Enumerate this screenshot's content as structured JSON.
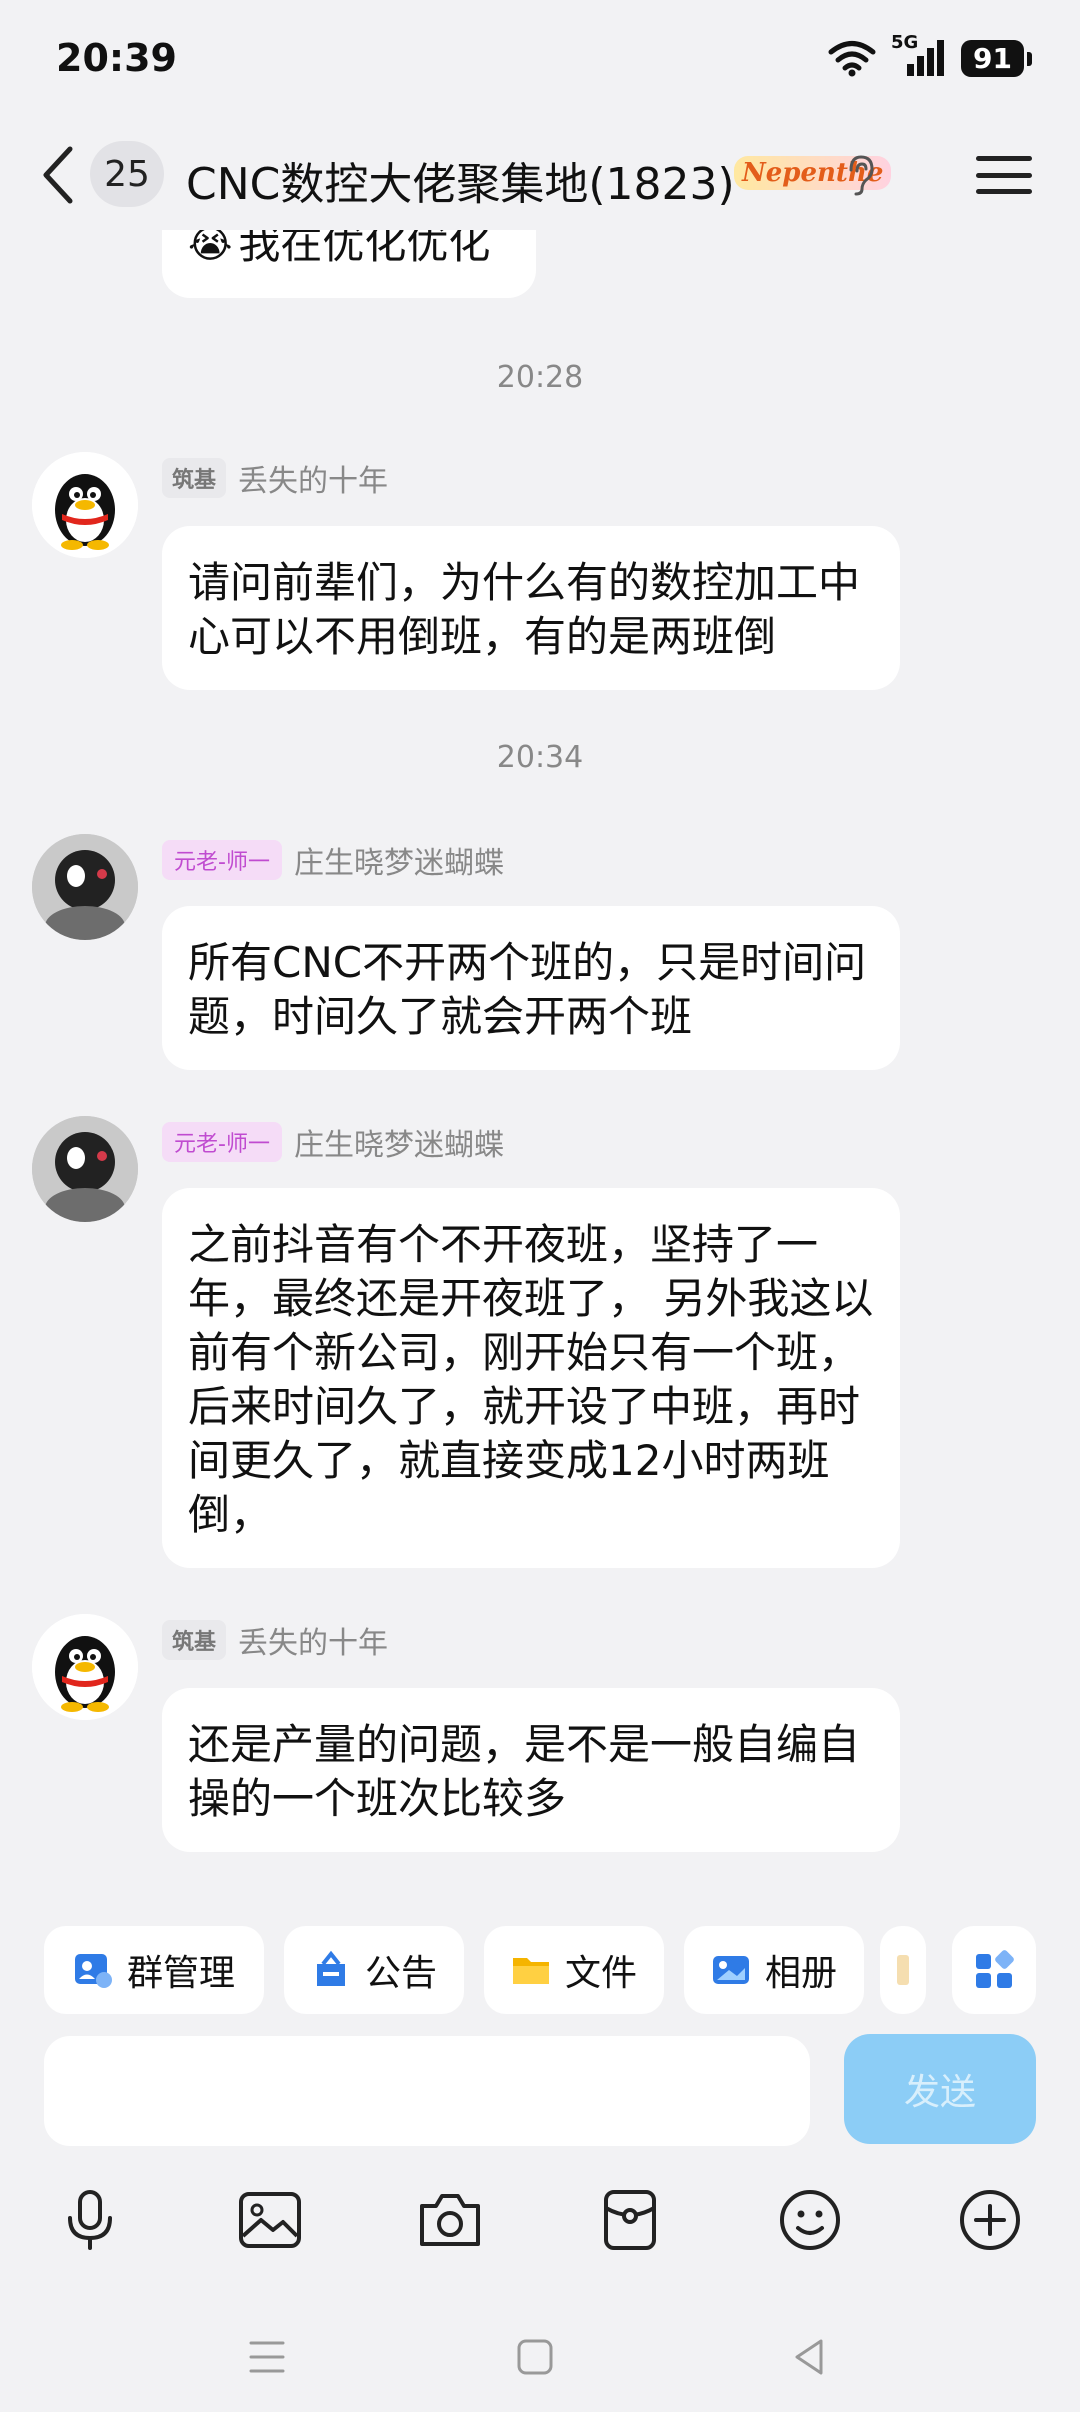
{
  "status_bar": {
    "time": "20:39",
    "network": "5G",
    "battery": "91"
  },
  "header": {
    "unread_count": "25",
    "title": "CNC数控大佬聚集地(1823)",
    "title_badge": "Nepenthe"
  },
  "messages": [
    {
      "text": "我在优化优化"
    },
    {
      "timestamp": "20:28"
    },
    {
      "level_badge": "筑基",
      "sender": "丢失的十年",
      "text": "请问前辈们，为什么有的数控加工中心可以不用倒班，有的是两班倒"
    },
    {
      "timestamp": "20:34"
    },
    {
      "level_badge": "元老-师一",
      "sender": "庄生晓梦迷蝴蝶",
      "text": "所有CNC不开两个班的，只是时间问题，时间久了就会开两个班"
    },
    {
      "level_badge": "元老-师一",
      "sender": "庄生晓梦迷蝴蝶",
      "text": "之前抖音有个不开夜班，坚持了一年，最终还是开夜班了，  另外我这以前有个新公司，刚开始只有一个班，后来时间久了，就开设了中班，再时间更久了，就直接变成12小时两班倒，"
    },
    {
      "level_badge": "筑基",
      "sender": "丢失的十年",
      "text": "还是产量的问题，是不是一般自编自操的一个班次比较多"
    }
  ],
  "toolbar": {
    "group_manage": "群管理",
    "announcement": "公告",
    "files": "文件",
    "album": "相册"
  },
  "composer": {
    "input_value": "",
    "send_label": "发送"
  },
  "colors": {
    "send_button": "#8ccdf6",
    "elder_badge": "#c04bd0",
    "background": "#f2f2f4"
  }
}
